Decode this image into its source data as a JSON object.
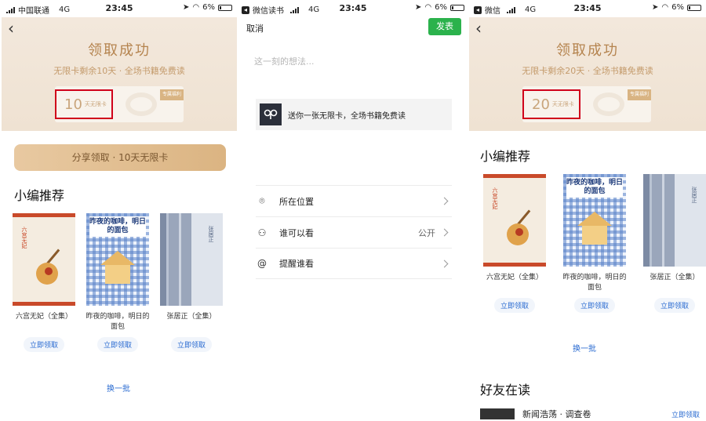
{
  "screen1": {
    "status": {
      "carrier": "中国联通",
      "network": "4G",
      "time": "23:45",
      "battery": "6%"
    },
    "header": {
      "title": "领取成功",
      "subtitle": "无限卡剩余10天 · 全场书籍免费读"
    },
    "card": {
      "number": "10",
      "unit": "天无限卡",
      "corner": "专属福利"
    },
    "share_button": "分享领取 · 10天无限卡",
    "section_title": "小编推荐",
    "books": [
      {
        "title": "六宫无妃（全集）",
        "cover_text": "六宫无妃",
        "button": "立即领取"
      },
      {
        "title": "昨夜的咖啡，明日的面包",
        "cover_text": "昨夜的咖啡，明日的面包",
        "button": "立即领取"
      },
      {
        "title": "张居正（全集）",
        "cover_text": "张居正",
        "button": "立即领取"
      }
    ],
    "more": "换一批"
  },
  "screen2": {
    "status": {
      "back_app": "微信读书",
      "network": "4G",
      "time": "23:45",
      "battery": "6%"
    },
    "cancel": "取消",
    "publish": "发表",
    "placeholder": "这一刻的想法...",
    "link_text": "送你一张无限卡，全场书籍免费读",
    "options": [
      {
        "label": "所在位置",
        "value": "",
        "icon": "location-icon"
      },
      {
        "label": "谁可以看",
        "value": "公开",
        "icon": "person-icon"
      },
      {
        "label": "提醒谁看",
        "value": "",
        "icon": "at-icon"
      }
    ]
  },
  "screen3": {
    "status": {
      "back_app": "微信",
      "network": "4G",
      "time": "23:45",
      "battery": "6%"
    },
    "header": {
      "title": "领取成功",
      "subtitle": "无限卡剩余20天 · 全场书籍免费读"
    },
    "card": {
      "number": "20",
      "unit": "天无限卡",
      "corner": "专属福利"
    },
    "section_title": "小编推荐",
    "books": [
      {
        "title": "六宫无妃（全集）",
        "cover_text": "六宫无妃",
        "button": "立即领取"
      },
      {
        "title": "昨夜的咖啡，明日的面包",
        "cover_text": "昨夜的咖啡，明日的面包",
        "button": "立即领取"
      },
      {
        "title": "张居正（全集）",
        "cover_text": "张居正",
        "button": "立即领取"
      }
    ],
    "more": "换一批",
    "friends_title": "好友在读",
    "friend_item": {
      "title": "新闻浩荡 · 调查卷",
      "button": "立即领取"
    }
  },
  "colors": {
    "accent_gold": "#b5844f",
    "link_blue": "#2a6bd1",
    "publish_green": "#2bb24c",
    "highlight_red": "#d0021b"
  }
}
